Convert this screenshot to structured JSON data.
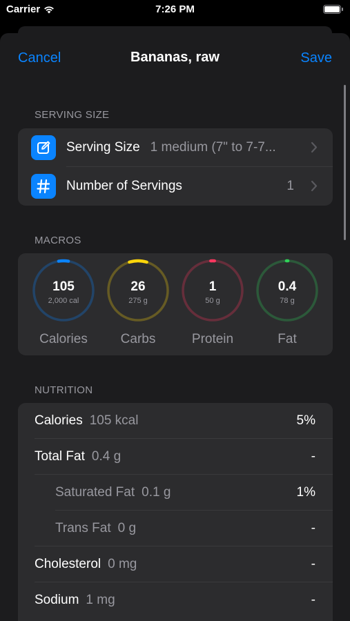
{
  "status_bar": {
    "carrier": "Carrier",
    "time": "7:26 PM"
  },
  "nav": {
    "cancel": "Cancel",
    "title": "Bananas, raw",
    "save": "Save"
  },
  "serving_section": {
    "header": "SERVING SIZE",
    "rows": [
      {
        "icon": "edit-square-icon",
        "label": "Serving Size",
        "value": "1 medium (7\" to 7-7..."
      },
      {
        "icon": "hashtag-icon",
        "label": "Number of Servings",
        "value": "1"
      }
    ]
  },
  "macros_section": {
    "header": "MACROS",
    "items": [
      {
        "value": "105",
        "goal": "2,000 cal",
        "name": "Calories",
        "color": "#0a84ff",
        "fraction": 0.0525
      },
      {
        "value": "26",
        "goal": "275 g",
        "name": "Carbs",
        "color": "#ffd60a",
        "fraction": 0.0945
      },
      {
        "value": "1",
        "goal": "50 g",
        "name": "Protein",
        "color": "#ff375f",
        "fraction": 0.02
      },
      {
        "value": "0.4",
        "goal": "78 g",
        "name": "Fat",
        "color": "#30d158",
        "fraction": 0.005
      }
    ]
  },
  "nutrition_section": {
    "header": "NUTRITION",
    "rows": [
      {
        "label": "Calories",
        "amount": "105 kcal",
        "percent": "5%",
        "indent": false
      },
      {
        "label": "Total Fat",
        "amount": "0.4 g",
        "percent": "-",
        "indent": false
      },
      {
        "label": "Saturated Fat",
        "amount": "0.1 g",
        "percent": "1%",
        "indent": true
      },
      {
        "label": "Trans Fat",
        "amount": "0 g",
        "percent": "-",
        "indent": true
      },
      {
        "label": "Cholesterol",
        "amount": "0 mg",
        "percent": "-",
        "indent": false
      },
      {
        "label": "Sodium",
        "amount": "1 mg",
        "percent": "-",
        "indent": false
      }
    ]
  }
}
